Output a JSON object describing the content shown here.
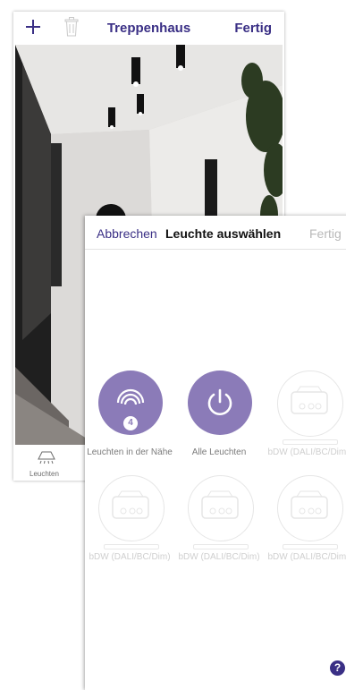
{
  "back_screen": {
    "title": "Treppenhaus",
    "done_label": "Fertig",
    "tab_label": "Leuchten"
  },
  "sheet": {
    "cancel_label": "Abbrechen",
    "title": "Leuchte auswählen",
    "done_label": "Fertig",
    "tiles": [
      {
        "label": "Leuchten in der Nähe",
        "badge": "4",
        "icon": "wifi-broadcast-icon",
        "enabled": true
      },
      {
        "label": "Alle Leuchten",
        "icon": "power-icon",
        "enabled": true
      },
      {
        "label": "bDW (DALI/BC/Dim)",
        "icon": "device-icon",
        "enabled": false
      },
      {
        "label": "bDW (DALI/BC/Dim)",
        "icon": "device-icon",
        "enabled": false
      },
      {
        "label": "bDW (DALI/BC/Dim)",
        "icon": "device-icon",
        "enabled": false
      },
      {
        "label": "bDW (DALI/BC/Dim)",
        "icon": "device-icon",
        "enabled": false
      }
    ]
  },
  "help_label": "?",
  "colors": {
    "accent": "#3a2f85",
    "tile_purple": "#8b7bb8",
    "disabled": "#cfcfcf"
  }
}
